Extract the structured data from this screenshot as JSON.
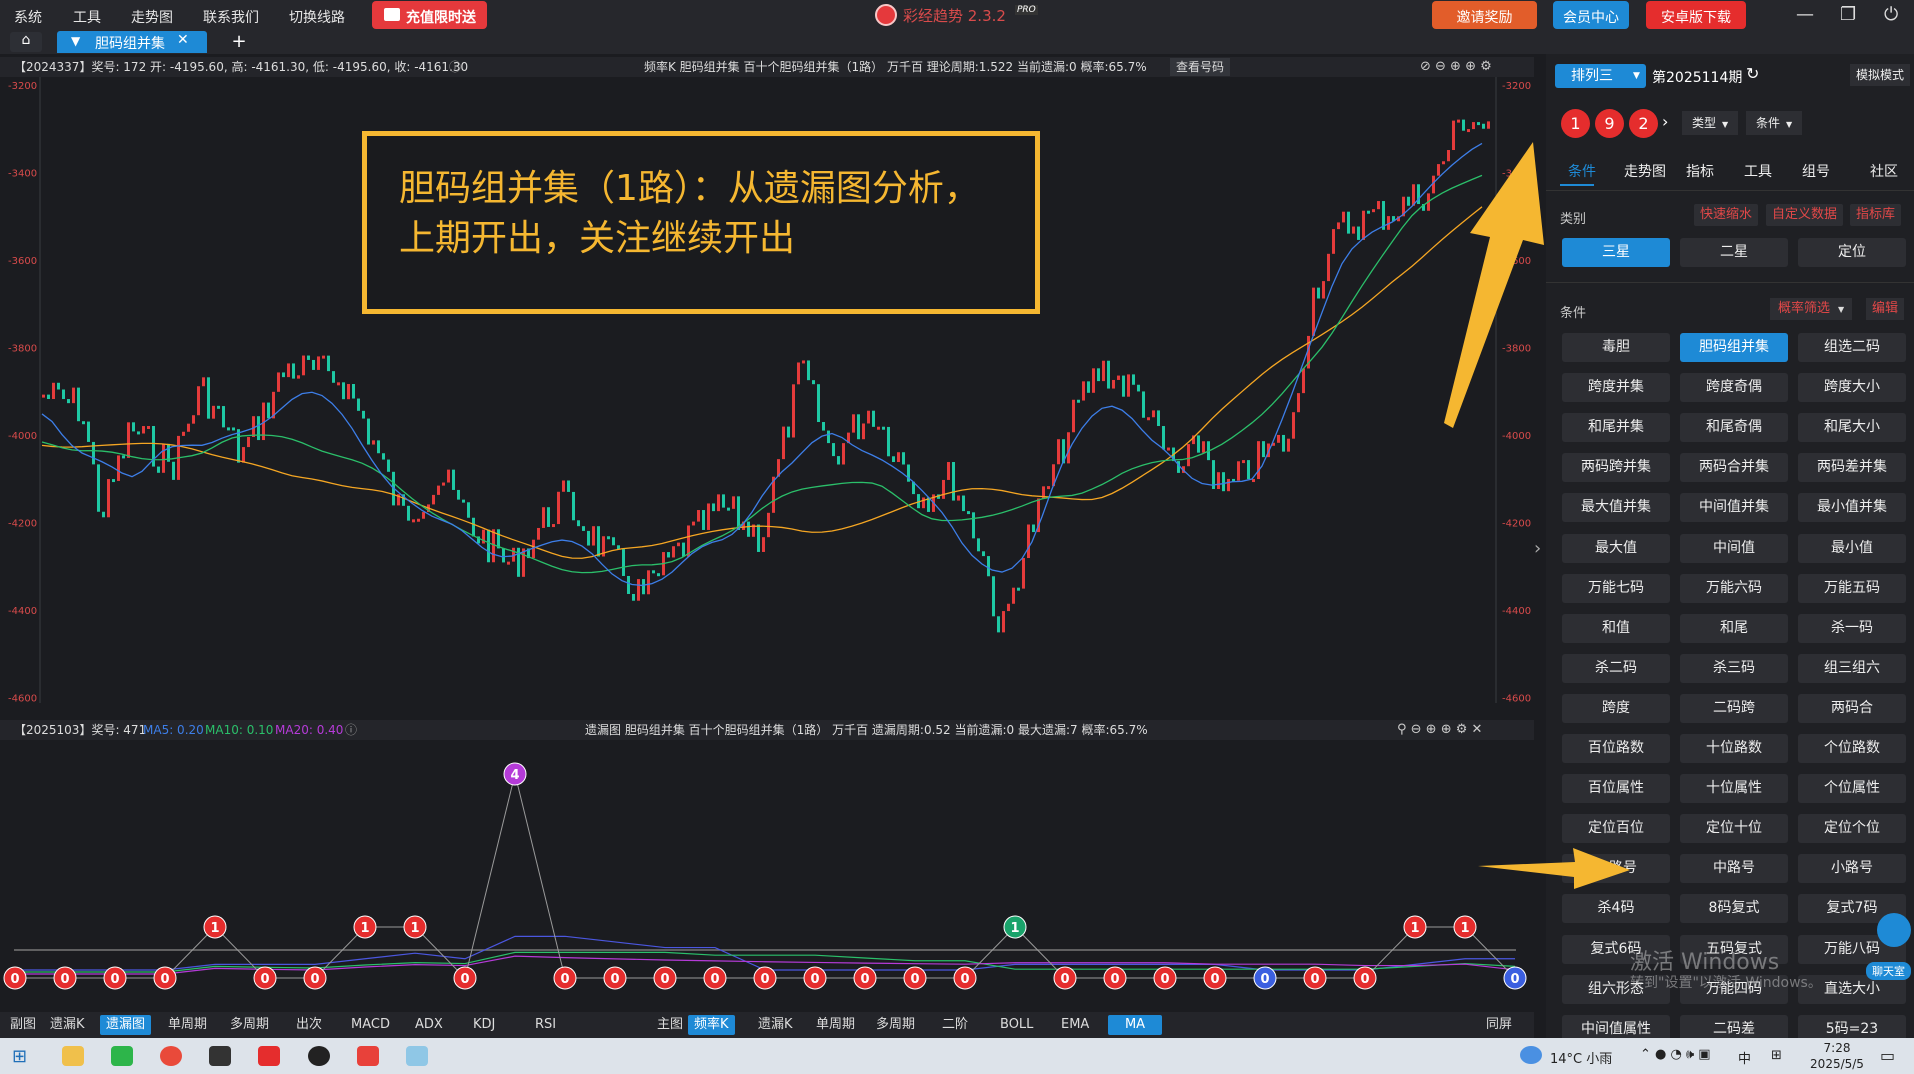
{
  "menu": [
    "系统",
    "工具",
    "走势图",
    "联系我们",
    "切换线路"
  ],
  "promo_label": "充值限时送",
  "app": {
    "name": "彩经趋势 2.3.2",
    "badge": "PRO"
  },
  "top_buttons": {
    "invite": "邀请奖励",
    "member": "会员中心",
    "android": "安卓版下载"
  },
  "tab": {
    "home_icon": "home-icon",
    "label": "胆码组并集",
    "close": "✕",
    "add": "+"
  },
  "top_chart": {
    "info_left": "【2024337】奖号: 172  开: -4195.60, 高: -4161.30, 低: -4195.60, 收: -4161.30",
    "info_mid": "频率K  胆码组并集  百十个胆码组并集（1路）  万千百  理论周期:1.522  当前遗漏:0  概率:65.7%",
    "view_btn": "查看号码",
    "y_ticks": [
      "-3200",
      "-3400",
      "-3600",
      "-3800",
      "-4000",
      "-4200",
      "-4400",
      "-4600"
    ]
  },
  "annotation": {
    "line1": "胆码组并集（1路）：从遗漏图分析，",
    "line2": "上期开出，关注继续开出"
  },
  "bottom_chart": {
    "info_left": "【2025103】奖号: 471",
    "ma5": "MA5: 0.20",
    "ma10": "MA10: 0.10",
    "ma20": "MA20: 0.40",
    "info_mid": "遗漏图  胆码组并集  百十个胆码组并集（1路）  万千百  遗漏周期:0.52  当前遗漏:0  最大遗漏:7  概率:65.7%",
    "chart_data": {
      "type": "line",
      "title": "遗漏图",
      "values": [
        0,
        0,
        0,
        0,
        1,
        0,
        0,
        1,
        1,
        0,
        4,
        0,
        0,
        0,
        0,
        0,
        0,
        0,
        0,
        0,
        1,
        0,
        0,
        0,
        0,
        0,
        0,
        0,
        1,
        1,
        0
      ],
      "colors": [
        "red",
        "red",
        "red",
        "red",
        "red",
        "red",
        "red",
        "red",
        "red",
        "red",
        "purple",
        "red",
        "red",
        "red",
        "red",
        "red",
        "red",
        "red",
        "red",
        "red",
        "green",
        "red",
        "red",
        "red",
        "red",
        "blue",
        "red",
        "red",
        "red",
        "red",
        "blue"
      ]
    }
  },
  "bottom_bar": {
    "left": [
      "副图",
      "遗漏K",
      "遗漏图",
      "单周期",
      "多周期",
      "出次",
      "MACD",
      "ADX",
      "KDJ",
      "RSI"
    ],
    "left_selected": "遗漏图",
    "right": [
      "主图",
      "频率K",
      "遗漏K",
      "单周期",
      "多周期",
      "二阶",
      "BOLL",
      "EMA",
      "MA"
    ],
    "right_selected": [
      "频率K",
      "MA"
    ],
    "sync": "同屏"
  },
  "right_panel": {
    "lottery_select": "排列三",
    "period": "第2025114期",
    "mode": "模拟模式",
    "balls": [
      "1",
      "9",
      "2"
    ],
    "type_label": "类型",
    "cond_label": "条件",
    "tabs": [
      "条件",
      "走势图",
      "指标",
      "工具",
      "组号",
      "社区"
    ],
    "category_label": "类别",
    "quick_buttons": [
      "快速缩水",
      "自定义数据",
      "指标库"
    ],
    "categories": [
      "三星",
      "二星",
      "定位"
    ],
    "conditions_label": "条件",
    "filter": "概率筛选",
    "edit": "编辑",
    "selected_condition": "胆码组并集",
    "conditions": [
      "毒胆",
      "胆码组并集",
      "组选二码",
      "跨度并集",
      "跨度奇偶",
      "跨度大小",
      "和尾并集",
      "和尾奇偶",
      "和尾大小",
      "两码跨并集",
      "两码合并集",
      "两码差并集",
      "最大值并集",
      "中间值并集",
      "最小值并集",
      "最大值",
      "中间值",
      "最小值",
      "万能七码",
      "万能六码",
      "万能五码",
      "和值",
      "和尾",
      "杀一码",
      "杀二码",
      "杀三码",
      "组三组六",
      "跨度",
      "二码跨",
      "两码合",
      "百位路数",
      "十位路数",
      "个位路数",
      "百位属性",
      "十位属性",
      "个位属性",
      "定位百位",
      "定位十位",
      "定位个位",
      "大路号",
      "中路号",
      "小路号",
      "杀4码",
      "8码复式",
      "复式7码",
      "复式6码",
      "五码复式",
      "万能八码",
      "组六形态",
      "万能四码",
      "直选大小",
      "中间值属性",
      "二码差",
      "5码=23"
    ]
  },
  "watermark": {
    "line1": "激活 Windows",
    "line2": "转到\"设置\"以激活 Windows。"
  },
  "chat_label": "聊天室",
  "taskbar": {
    "weather": "14°C 小雨",
    "ime": "中",
    "time": "7:28",
    "date": "2025/5/5"
  }
}
